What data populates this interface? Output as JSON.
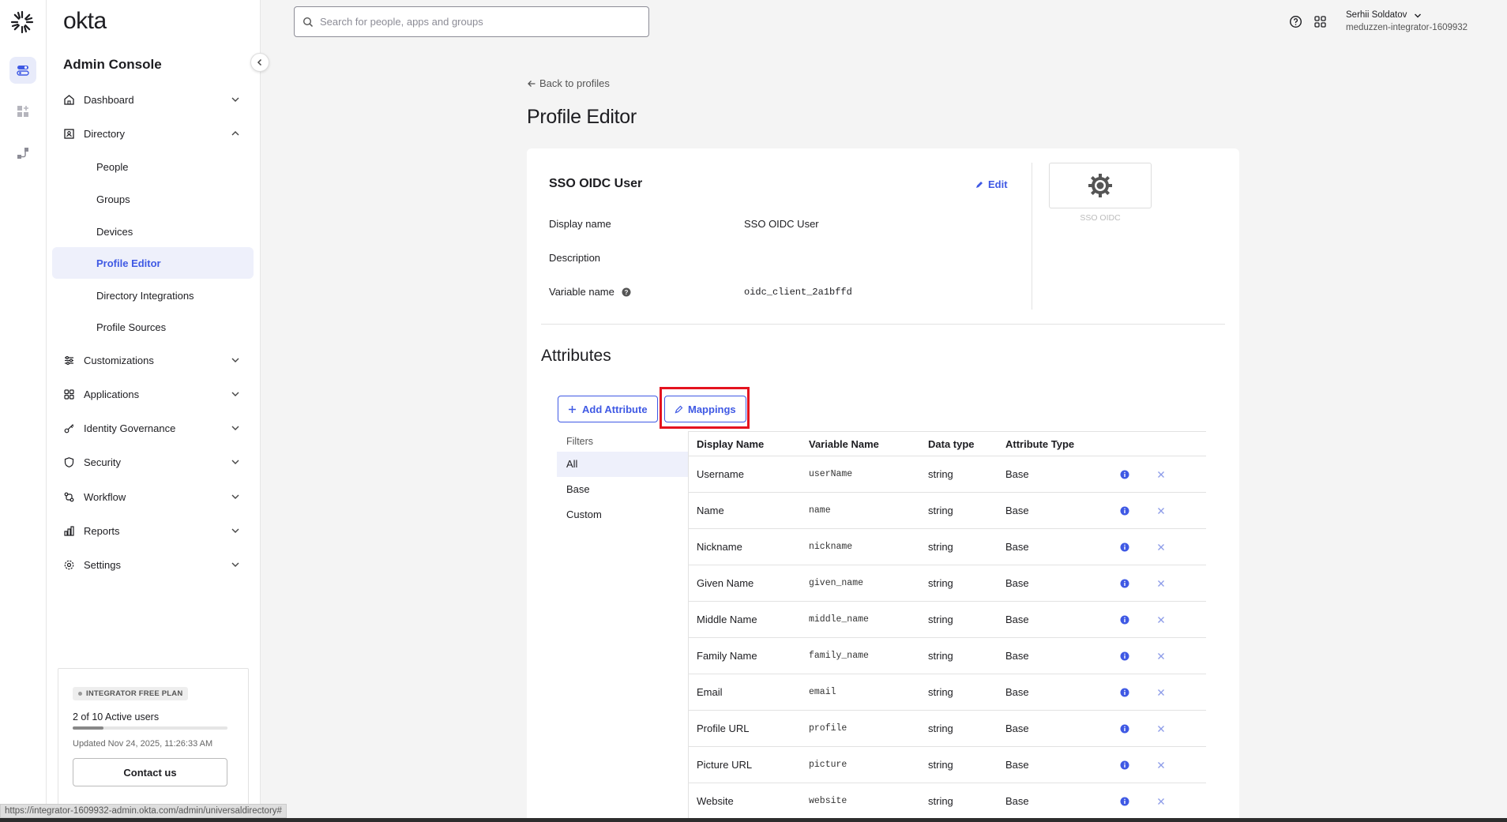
{
  "app": {
    "brand": "okta",
    "console_title": "Admin Console"
  },
  "search": {
    "placeholder": "Search for people, apps and groups"
  },
  "user": {
    "name": "Serhii Soldatov",
    "org": "meduzzen-integrator-1609932"
  },
  "nav": {
    "dashboard": "Dashboard",
    "directory": "Directory",
    "directory_items": [
      "People",
      "Groups",
      "Devices",
      "Profile Editor",
      "Directory Integrations",
      "Profile Sources"
    ],
    "customizations": "Customizations",
    "applications": "Applications",
    "identity_governance": "Identity Governance",
    "security": "Security",
    "workflow": "Workflow",
    "reports": "Reports",
    "settings": "Settings"
  },
  "plan": {
    "badge": "INTEGRATOR FREE PLAN",
    "users": "2 of 10 Active users",
    "users_fraction": 0.2,
    "updated": "Updated Nov 24, 2025, 11:26:33 AM",
    "contact": "Contact us"
  },
  "page": {
    "back": "Back to profiles",
    "title": "Profile Editor"
  },
  "profile": {
    "name": "SSO OIDC User",
    "edit": "Edit",
    "display_name_label": "Display name",
    "display_name": "SSO OIDC User",
    "description_label": "Description",
    "description": "",
    "variable_name_label": "Variable name",
    "variable_name": "oidc_client_2a1bffd",
    "logo_caption": "SSO OIDC"
  },
  "attributes": {
    "title": "Attributes",
    "add_button": "Add Attribute",
    "mappings_button": "Mappings",
    "filters_label": "Filters",
    "filters": [
      "All",
      "Base",
      "Custom"
    ],
    "columns": [
      "Display Name",
      "Variable Name",
      "Data type",
      "Attribute Type"
    ],
    "rows": [
      {
        "display": "Username",
        "variable": "userName",
        "type": "string",
        "attr_type": "Base"
      },
      {
        "display": "Name",
        "variable": "name",
        "type": "string",
        "attr_type": "Base"
      },
      {
        "display": "Nickname",
        "variable": "nickname",
        "type": "string",
        "attr_type": "Base"
      },
      {
        "display": "Given Name",
        "variable": "given_name",
        "type": "string",
        "attr_type": "Base"
      },
      {
        "display": "Middle Name",
        "variable": "middle_name",
        "type": "string",
        "attr_type": "Base"
      },
      {
        "display": "Family Name",
        "variable": "family_name",
        "type": "string",
        "attr_type": "Base"
      },
      {
        "display": "Email",
        "variable": "email",
        "type": "string",
        "attr_type": "Base"
      },
      {
        "display": "Profile URL",
        "variable": "profile",
        "type": "string",
        "attr_type": "Base"
      },
      {
        "display": "Picture URL",
        "variable": "picture",
        "type": "string",
        "attr_type": "Base"
      },
      {
        "display": "Website",
        "variable": "website",
        "type": "string",
        "attr_type": "Base"
      }
    ]
  },
  "status_bar": "https://integrator-1609932-admin.okta.com/admin/universaldirectory#",
  "colors": {
    "accent": "#3f59e4",
    "highlight": "#e4131f"
  }
}
